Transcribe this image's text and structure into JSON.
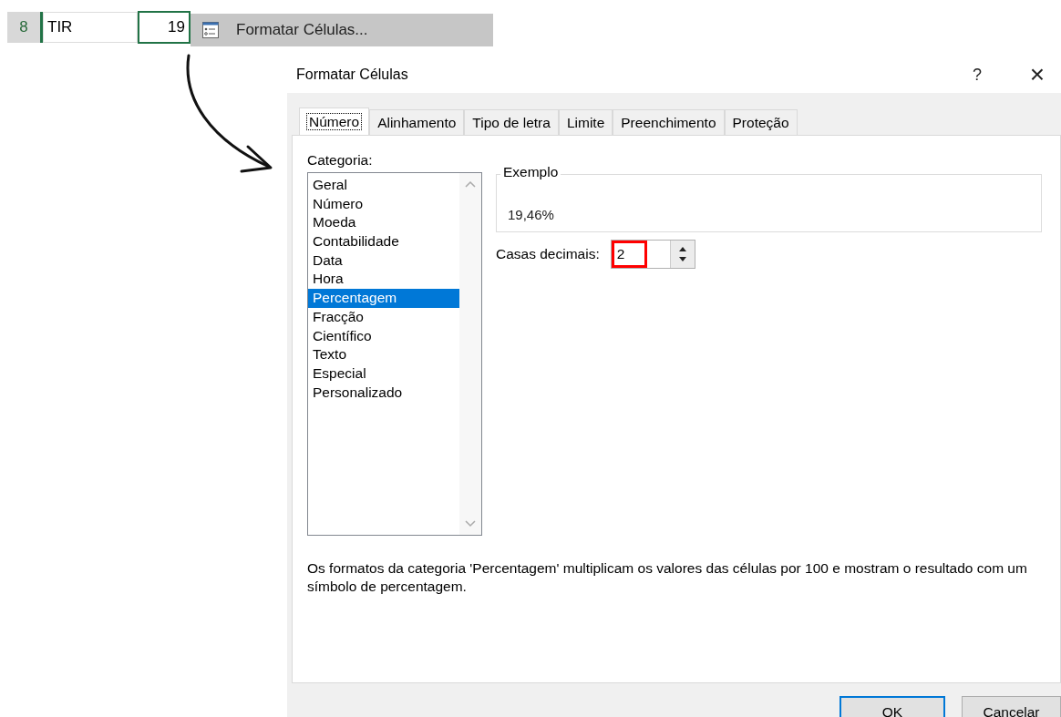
{
  "spreadsheet": {
    "row_header": "8",
    "cells": [
      {
        "value": "TIR",
        "selected": false
      },
      {
        "value": "19",
        "selected": true
      }
    ]
  },
  "context_menu": {
    "item": "Formatar Células..."
  },
  "dialog": {
    "title": "Formatar Células",
    "help": "?",
    "close": "×",
    "tabs": [
      {
        "label": "Número",
        "selected": true
      },
      {
        "label": "Alinhamento",
        "selected": false
      },
      {
        "label": "Tipo de letra",
        "selected": false
      },
      {
        "label": "Limite",
        "selected": false
      },
      {
        "label": "Preenchimento",
        "selected": false
      },
      {
        "label": "Proteção",
        "selected": false
      }
    ],
    "category_label": "Categoria:",
    "categories": [
      {
        "label": "Geral",
        "selected": false
      },
      {
        "label": "Número",
        "selected": false
      },
      {
        "label": "Moeda",
        "selected": false
      },
      {
        "label": "Contabilidade",
        "selected": false
      },
      {
        "label": "Data",
        "selected": false
      },
      {
        "label": "Hora",
        "selected": false
      },
      {
        "label": "Percentagem",
        "selected": true
      },
      {
        "label": "Fracção",
        "selected": false
      },
      {
        "label": "Científico",
        "selected": false
      },
      {
        "label": "Texto",
        "selected": false
      },
      {
        "label": "Especial",
        "selected": false
      },
      {
        "label": "Personalizado",
        "selected": false
      }
    ],
    "sample": {
      "legend": "Exemplo",
      "value": "19,46%"
    },
    "decimal_places": {
      "label": "Casas decimais:",
      "value": "2",
      "highlighted": true
    },
    "description": "Os formatos da categoria 'Percentagem' multiplicam os valores das células por 100 e mostram o resultado com um símbolo de percentagem.",
    "buttons": [
      {
        "label": "OK",
        "default": true
      },
      {
        "label": "Cancelar",
        "default": false
      }
    ]
  }
}
